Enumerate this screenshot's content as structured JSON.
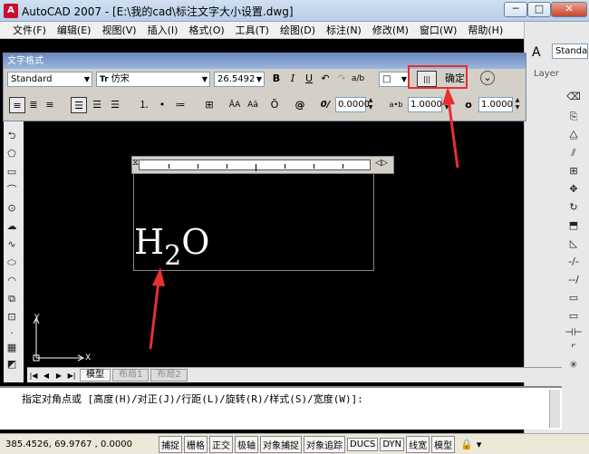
{
  "window": {
    "title": "AutoCAD 2007 - [E:\\我的cad\\标注文字大小设置.dwg]",
    "minimize": "─",
    "maximize": "□",
    "close": "✕"
  },
  "menu": [
    "文件(F)",
    "编辑(E)",
    "视图(V)",
    "插入(I)",
    "格式(O)",
    "工具(T)",
    "绘图(D)",
    "标注(N)",
    "修改(M)",
    "窗口(W)",
    "帮助(H)"
  ],
  "right_panel": {
    "style_value": "Standa",
    "layer_label": "Layer"
  },
  "text_format": {
    "title": "文字格式",
    "style_select": "Standard",
    "font_select": "仿宋",
    "font_prefix": "Tr",
    "height_select": "26.5492",
    "bold": "B",
    "italic": "I",
    "underline": "U",
    "color_swatch": "□",
    "ruler_toggle": "|||",
    "ok_label": "确定",
    "options": "⌄",
    "oblique_value": "0.0000",
    "tracking_value": "1.0000",
    "width_value": "1.0000",
    "at_symbol": "@",
    "oblique_icon": "0/",
    "tracking_icon": "a•b",
    "width_icon": "o",
    "stack_icon": "a/b",
    "upper_icon": "ĀA",
    "lower_icon": "Aā",
    "overline_icon": "Ō"
  },
  "canvas": {
    "content_main": "H",
    "content_sub": "2",
    "content_end": "O",
    "axis_x": "X",
    "axis_y": "Y"
  },
  "tabs": {
    "model": "模型",
    "layout1": "布局1",
    "layout2": "布局2"
  },
  "command": {
    "prompt": "指定对角点或 [高度(H)/对正(J)/行距(L)/旋转(R)/样式(S)/宽度(W)]:"
  },
  "status": {
    "coords": "385.4526, 69.9767 , 0.0000",
    "buttons": [
      "捕捉",
      "栅格",
      "正交",
      "极轴",
      "对象捕捉",
      "对象追踪",
      "DUCS",
      "DYN",
      "线宽",
      "模型"
    ]
  },
  "colors": {
    "annotation_red": "#e53030",
    "canvas_bg": "#000000"
  }
}
